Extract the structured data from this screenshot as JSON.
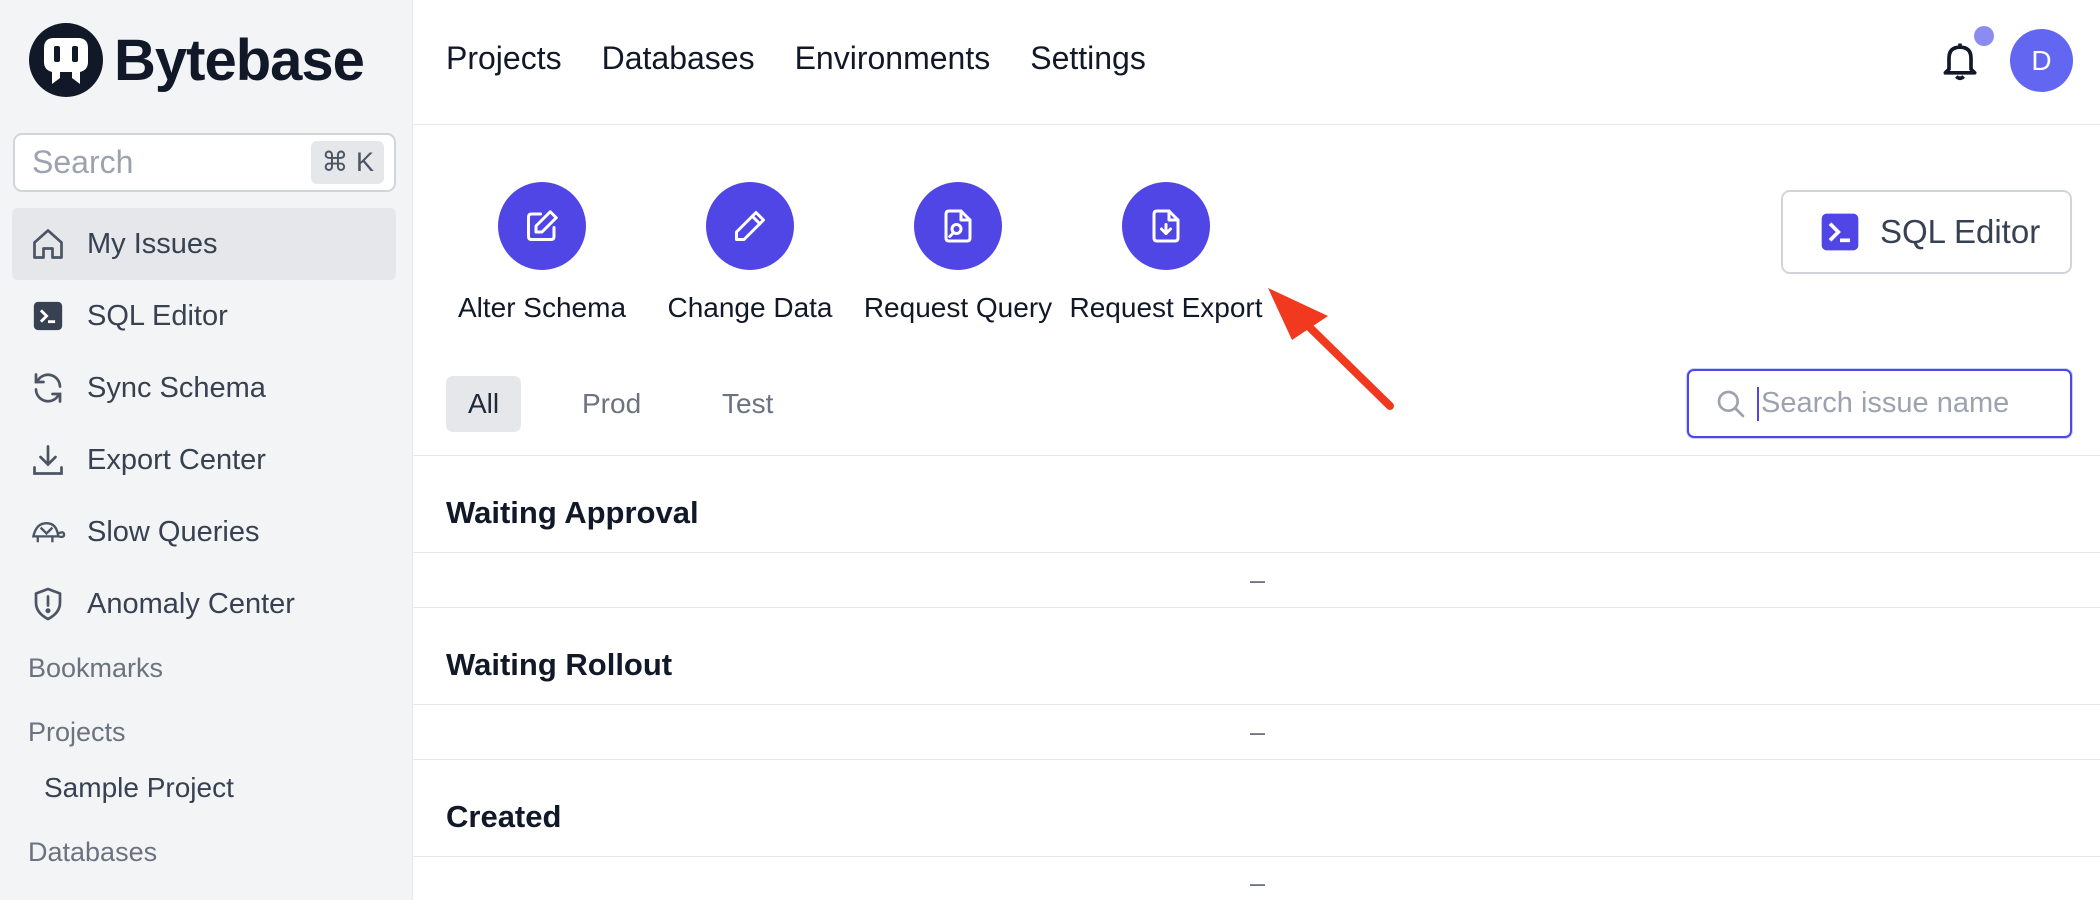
{
  "brand": {
    "name": "Bytebase"
  },
  "sidebar": {
    "search_placeholder": "Search",
    "search_shortcut": "⌘ K",
    "items": [
      {
        "label": "My Issues",
        "icon": "home-icon",
        "active": true
      },
      {
        "label": "SQL Editor",
        "icon": "terminal-icon",
        "active": false
      },
      {
        "label": "Sync Schema",
        "icon": "refresh-icon",
        "active": false
      },
      {
        "label": "Export Center",
        "icon": "download-icon",
        "active": false
      },
      {
        "label": "Slow Queries",
        "icon": "turtle-icon",
        "active": false
      },
      {
        "label": "Anomaly Center",
        "icon": "shield-icon",
        "active": false
      }
    ],
    "sections": {
      "bookmarks": "Bookmarks",
      "projects": "Projects",
      "project_item": "Sample Project",
      "databases": "Databases"
    }
  },
  "header": {
    "nav": [
      "Projects",
      "Databases",
      "Environments",
      "Settings"
    ],
    "avatar_initial": "D"
  },
  "quick_actions": [
    {
      "label": "Alter Schema",
      "icon": "edit-square-icon"
    },
    {
      "label": "Change Data",
      "icon": "pencil-icon"
    },
    {
      "label": "Request Query",
      "icon": "file-search-icon"
    },
    {
      "label": "Request Export",
      "icon": "file-download-icon"
    }
  ],
  "sql_editor_button": {
    "label": "SQL Editor"
  },
  "tabs": [
    "All",
    "Prod",
    "Test"
  ],
  "issue_search": {
    "placeholder": "Search issue name"
  },
  "sections": [
    {
      "title": "Waiting Approval",
      "empty": "–"
    },
    {
      "title": "Waiting Rollout",
      "empty": "–"
    },
    {
      "title": "Created",
      "empty": "–"
    }
  ],
  "colors": {
    "accent": "#4f46e5",
    "avatar": "#6366f1",
    "arrow": "#f0391e"
  }
}
